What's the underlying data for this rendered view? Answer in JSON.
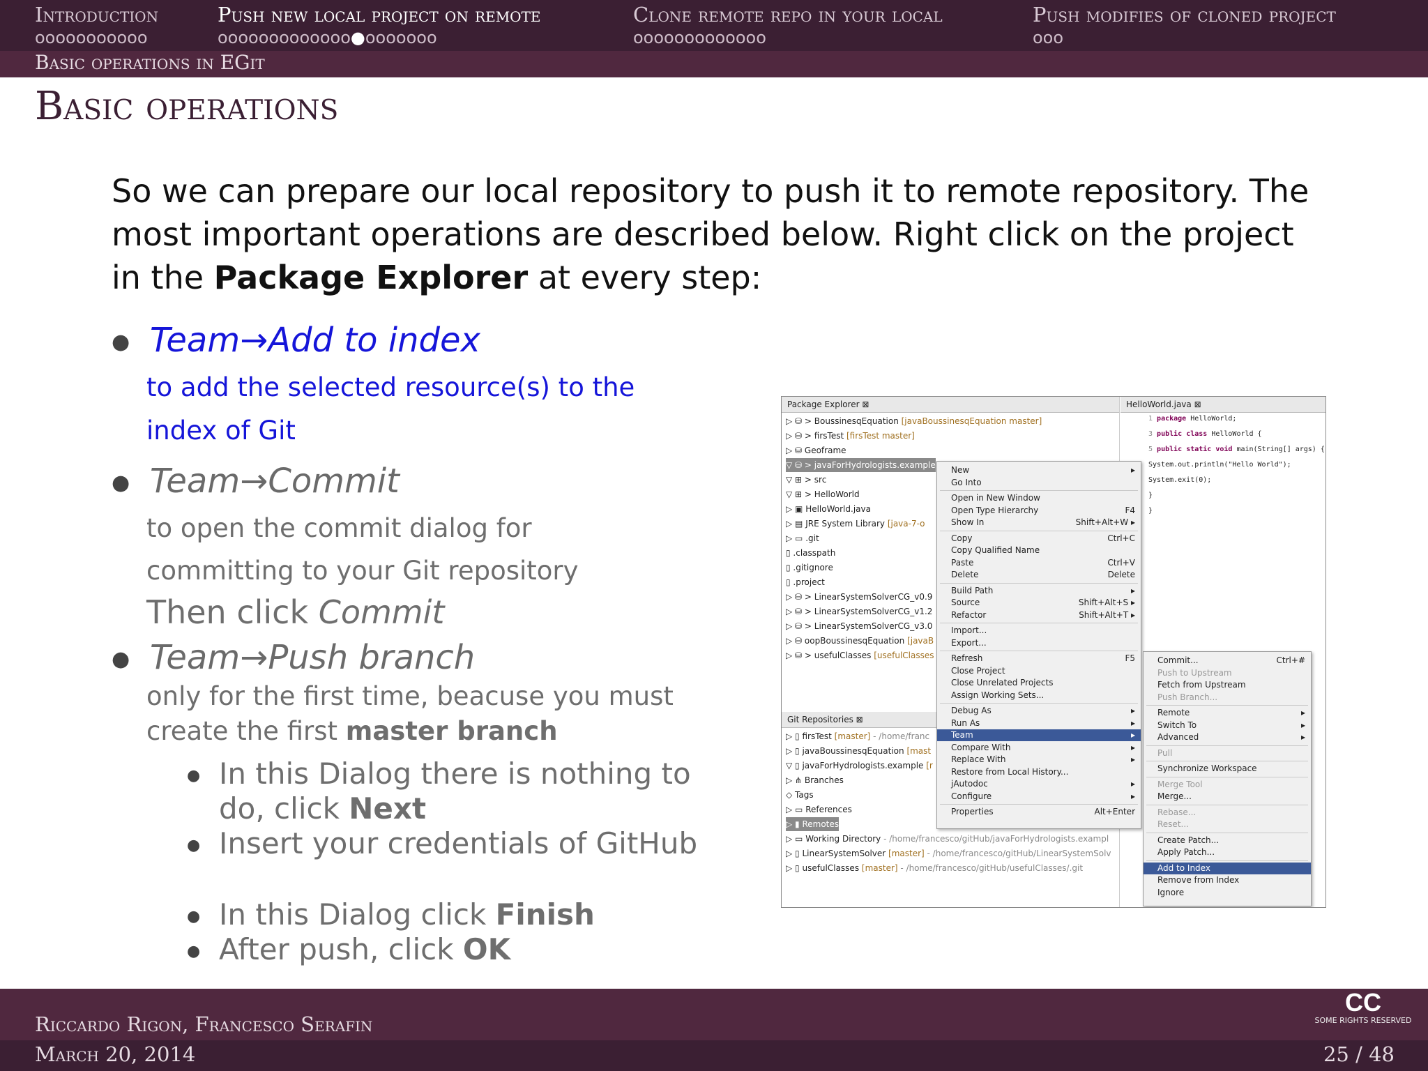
{
  "header": {
    "sections": [
      {
        "label": "Introduction",
        "dots": "ooooooooooo"
      },
      {
        "label": "Push new local project on remote",
        "dots_before": "ooooooooooooo",
        "dot_current": "●",
        "dots_after": "ooooooo"
      },
      {
        "label": "Clone remote repo in your local",
        "dots": "ooooooooooooo"
      },
      {
        "label": "Push modifies of cloned project",
        "dots": "ooo"
      }
    ],
    "subsection": "Basic operations in EGit"
  },
  "slide_title": "Basic operations",
  "intro": {
    "text_before": "So we can prepare our local repository to push it to remote repository. The most important operations are described below. Right click on the project in the ",
    "bold": "Package Explorer",
    "text_after": " at every step:"
  },
  "bullets": {
    "b1_title": "Team→Add to index",
    "b1_desc1": "to add the selected resource(s) to the",
    "b1_desc2": "index of Git",
    "b2_title": "Team→Commit",
    "b2_desc1": "to open the commit dialog for",
    "b2_desc2": "committing to your Git repository",
    "b2_then": "Then click ",
    "b2_then_em": "Commit",
    "b3_title": "Team→Push branch",
    "b3_desc1": "only for the first time, beacuse you must",
    "b3_desc2_pre": "create the first ",
    "b3_desc2_bold": "master branch",
    "s1_pre": "In this Dialog there is nothing to",
    "s1_pre2": "do, click ",
    "s1_bold": "Next",
    "s2": "Insert your credentials of GitHub",
    "s3_pre": "In this Dialog click ",
    "s3_bold": "Finish",
    "s4_pre": "After push, click ",
    "s4_bold": "OK"
  },
  "footer": {
    "authors": "Riccardo Rigon, Francesco Serafin",
    "date": "March 20, 2014",
    "page": "25 / 48",
    "cc": "CC",
    "cc_small": "SOME RIGHTS RESERVED"
  },
  "screenshot": {
    "pe_title": "Package Explorer ⊠",
    "pe_rows": [
      {
        "t": "▷ ⛁ > BoussinesqEquation",
        "a": " [javaBoussinesqEquation master]"
      },
      {
        "t": "▷ ⛁ > firsTest",
        "a": " [firsTest master]"
      },
      {
        "t": "▷ ⛁ Geoframe",
        "a": ""
      },
      {
        "t": "▽ ⛁ > javaForHydrologists.example",
        "a": ""
      },
      {
        "t": "   ▽ ⊞ > src",
        "a": ""
      },
      {
        "t": "      ▽ ⊞ > HelloWorld",
        "a": ""
      },
      {
        "t": "         ▷ ▣ HelloWorld.java",
        "a": ""
      },
      {
        "t": "   ▷ ▤ JRE System Library",
        "a": " [java-7-o"
      },
      {
        "t": "   ▷ ▭ .git",
        "a": ""
      },
      {
        "t": "      ▯ .classpath",
        "a": ""
      },
      {
        "t": "      ▯ .gitignore",
        "a": ""
      },
      {
        "t": "      ▯ .project",
        "a": ""
      },
      {
        "t": "▷ ⛁ > LinearSystemSolverCG_v0.9",
        "a": ""
      },
      {
        "t": "▷ ⛁ > LinearSystemSolverCG_v1.2",
        "a": ""
      },
      {
        "t": "▷ ⛁ > LinearSystemSolverCG_v3.0",
        "a": ""
      },
      {
        "t": "▷ ⛁ oopBoussinesqEquation",
        "a": " [javaB"
      },
      {
        "t": "▷ ⛁ > usefulClasses",
        "a": " [usefulClasses"
      }
    ],
    "git_title": "Git Repositories ⊠",
    "git_rows": [
      {
        "t": "▷ ▯ firsTest",
        "a": " [master]",
        "p": " - /home/franc"
      },
      {
        "t": "▷ ▯ javaBoussinesqEquation",
        "a": " [mast",
        "p": ""
      },
      {
        "t": "▽ ▯ javaForHydrologists.example",
        "a": " [r",
        "p": ""
      },
      {
        "t": "   ▷ ⋔ Branches",
        "a": "",
        "p": ""
      },
      {
        "t": "      ◇ Tags",
        "a": "",
        "p": ""
      },
      {
        "t": "   ▷ ▭ References",
        "a": "",
        "p": ""
      },
      {
        "t": "   ▷ ▮ Remotes",
        "a": "",
        "p": ""
      },
      {
        "t": "   ▷ ▭ Working Directory",
        "a": "",
        "p": " - /home/francesco/gitHub/javaForHydrologists.exampl"
      },
      {
        "t": "▷ ▯ LinearSystemSolver",
        "a": " [master]",
        "p": " - /home/francesco/gitHub/LinearSystemSolv"
      },
      {
        "t": "▷ ▯ usefulClasses",
        "a": " [master]",
        "p": " - /home/francesco/gitHub/usefulClasses/.git"
      }
    ],
    "editor_title": "HelloWorld.java ⊠",
    "code": [
      {
        "n": "1",
        "kw": "package",
        "rest": " HelloWorld;"
      },
      {
        "n": "3",
        "kw": "public class",
        "rest": " HelloWorld {"
      },
      {
        "n": "5",
        "kw": "  public static void",
        "rest": " main(String[] args) {"
      },
      {
        "n": "",
        "kw": "",
        "rest": "    System.out.println(\"Hello World\");"
      },
      {
        "n": "",
        "kw": "",
        "rest": "    System.exit(0);"
      },
      {
        "n": "",
        "kw": "",
        "rest": "  }"
      },
      {
        "n": "",
        "kw": "",
        "rest": "}"
      }
    ],
    "context_menu": [
      {
        "l": "New",
        "r": "▸"
      },
      {
        "l": "Go Into",
        "r": ""
      },
      {
        "sep": true
      },
      {
        "l": "Open in New Window",
        "r": ""
      },
      {
        "l": "Open Type Hierarchy",
        "r": "F4"
      },
      {
        "l": "Show In",
        "r": "Shift+Alt+W ▸"
      },
      {
        "sep": true
      },
      {
        "l": "Copy",
        "r": "Ctrl+C"
      },
      {
        "l": "Copy Qualified Name",
        "r": ""
      },
      {
        "l": "Paste",
        "r": "Ctrl+V"
      },
      {
        "l": "Delete",
        "r": "Delete"
      },
      {
        "sep": true
      },
      {
        "l": "Build Path",
        "r": "▸"
      },
      {
        "l": "Source",
        "r": "Shift+Alt+S ▸"
      },
      {
        "l": "Refactor",
        "r": "Shift+Alt+T ▸"
      },
      {
        "sep": true
      },
      {
        "l": "Import...",
        "r": ""
      },
      {
        "l": "Export...",
        "r": ""
      },
      {
        "sep": true
      },
      {
        "l": "Refresh",
        "r": "F5"
      },
      {
        "l": "Close Project",
        "r": ""
      },
      {
        "l": "Close Unrelated Projects",
        "r": ""
      },
      {
        "l": "Assign Working Sets...",
        "r": ""
      },
      {
        "sep": true
      },
      {
        "l": "Debug As",
        "r": "▸"
      },
      {
        "l": "Run As",
        "r": "▸"
      },
      {
        "l": "Team",
        "r": "▸",
        "hl": true
      },
      {
        "l": "Compare With",
        "r": "▸"
      },
      {
        "l": "Replace With",
        "r": "▸"
      },
      {
        "l": "Restore from Local History...",
        "r": ""
      },
      {
        "l": "jAutodoc",
        "r": "▸"
      },
      {
        "l": "Configure",
        "r": "▸"
      },
      {
        "sep": true
      },
      {
        "l": "Properties",
        "r": "Alt+Enter"
      }
    ],
    "team_menu": [
      {
        "l": "Commit...",
        "r": "Ctrl+#"
      },
      {
        "l": "Push to Upstream",
        "r": "",
        "dis": true
      },
      {
        "l": "Fetch from Upstream",
        "r": ""
      },
      {
        "l": "Push Branch...",
        "r": "",
        "dis": true
      },
      {
        "sep": true
      },
      {
        "l": "Remote",
        "r": "▸"
      },
      {
        "l": "Switch To",
        "r": "▸"
      },
      {
        "l": "Advanced",
        "r": "▸"
      },
      {
        "sep": true
      },
      {
        "l": "Pull",
        "r": "",
        "dis": true
      },
      {
        "sep": true
      },
      {
        "l": "Synchronize Workspace",
        "r": ""
      },
      {
        "sep": true
      },
      {
        "l": "Merge Tool",
        "r": "",
        "dis": true
      },
      {
        "l": "Merge...",
        "r": ""
      },
      {
        "sep": true
      },
      {
        "l": "Rebase...",
        "r": "",
        "dis": true
      },
      {
        "l": "Reset...",
        "r": "",
        "dis": true
      },
      {
        "sep": true
      },
      {
        "l": "Create Patch...",
        "r": ""
      },
      {
        "l": "Apply Patch...",
        "r": ""
      },
      {
        "sep": true
      },
      {
        "l": "Add to Index",
        "r": "",
        "hl": true
      },
      {
        "l": "Remove from Index",
        "r": ""
      },
      {
        "l": "Ignore",
        "r": ""
      }
    ]
  }
}
